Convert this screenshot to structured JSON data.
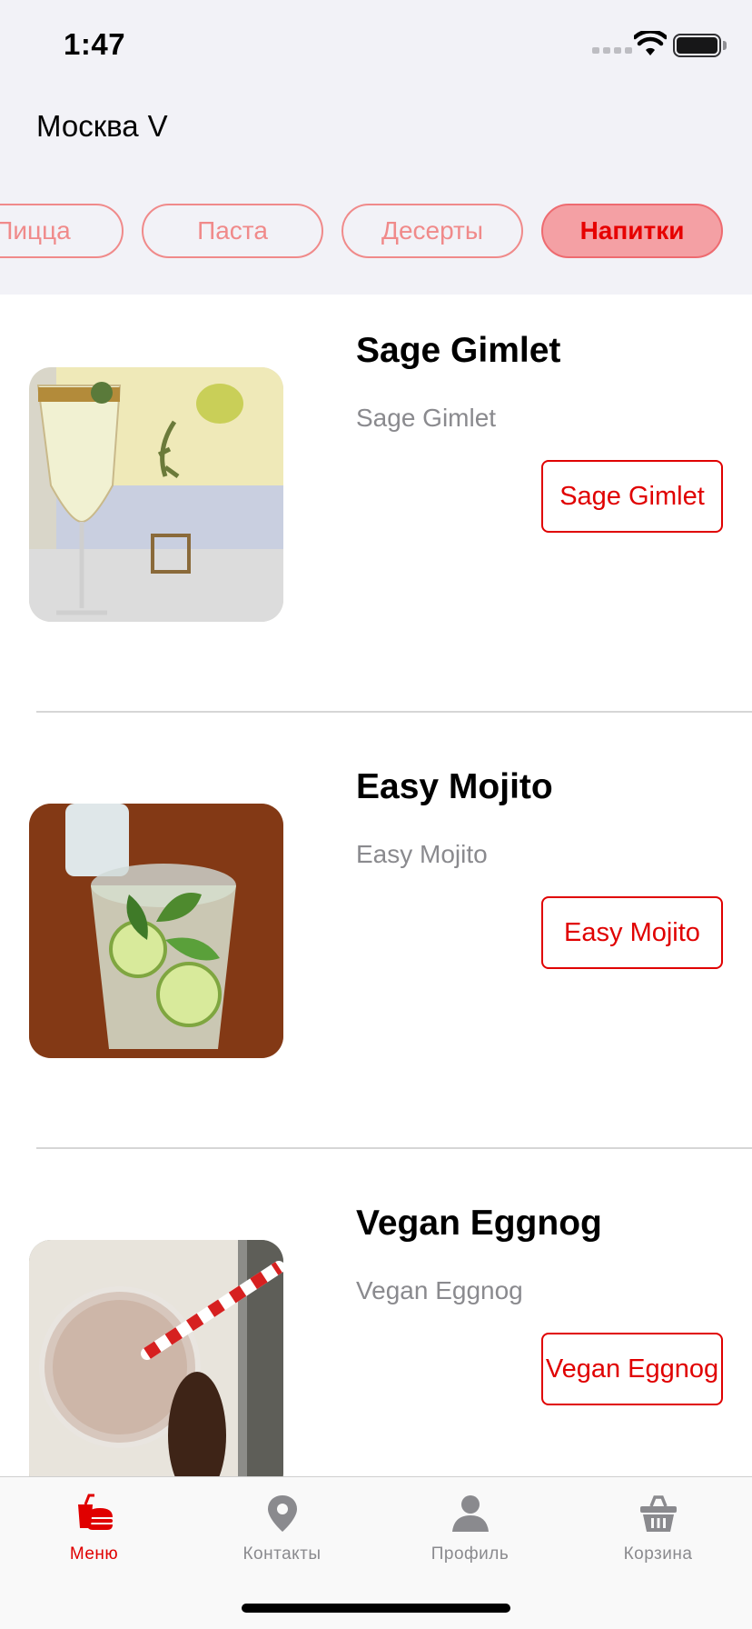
{
  "status_bar": {
    "time": "1:47"
  },
  "header": {
    "city": "Москва",
    "city_chevron": "V"
  },
  "categories": [
    {
      "label": "Пицца",
      "active": false
    },
    {
      "label": "Паста",
      "active": false
    },
    {
      "label": "Десерты",
      "active": false
    },
    {
      "label": "Напитки",
      "active": true
    }
  ],
  "menu_items": [
    {
      "title": "Sage Gimlet",
      "subtitle": "Sage Gimlet",
      "button": "Sage Gimlet"
    },
    {
      "title": "Easy Mojito",
      "subtitle": "Easy Mojito",
      "button": "Easy Mojito"
    },
    {
      "title": "Vegan Eggnog",
      "subtitle": "Vegan Eggnog",
      "button": "Vegan Eggnog"
    }
  ],
  "tab_bar": [
    {
      "label": "Меню",
      "icon": "burger-drink-icon",
      "active": true
    },
    {
      "label": "Контакты",
      "icon": "map-pin-icon",
      "active": false
    },
    {
      "label": "Профиль",
      "icon": "person-icon",
      "active": false
    },
    {
      "label": "Корзина",
      "icon": "basket-icon",
      "active": false
    }
  ],
  "colors": {
    "accent": "#e00000",
    "chip_border": "#f08a8a",
    "chip_active_bg": "#f4a0a4",
    "header_bg": "#f2f2f7"
  }
}
